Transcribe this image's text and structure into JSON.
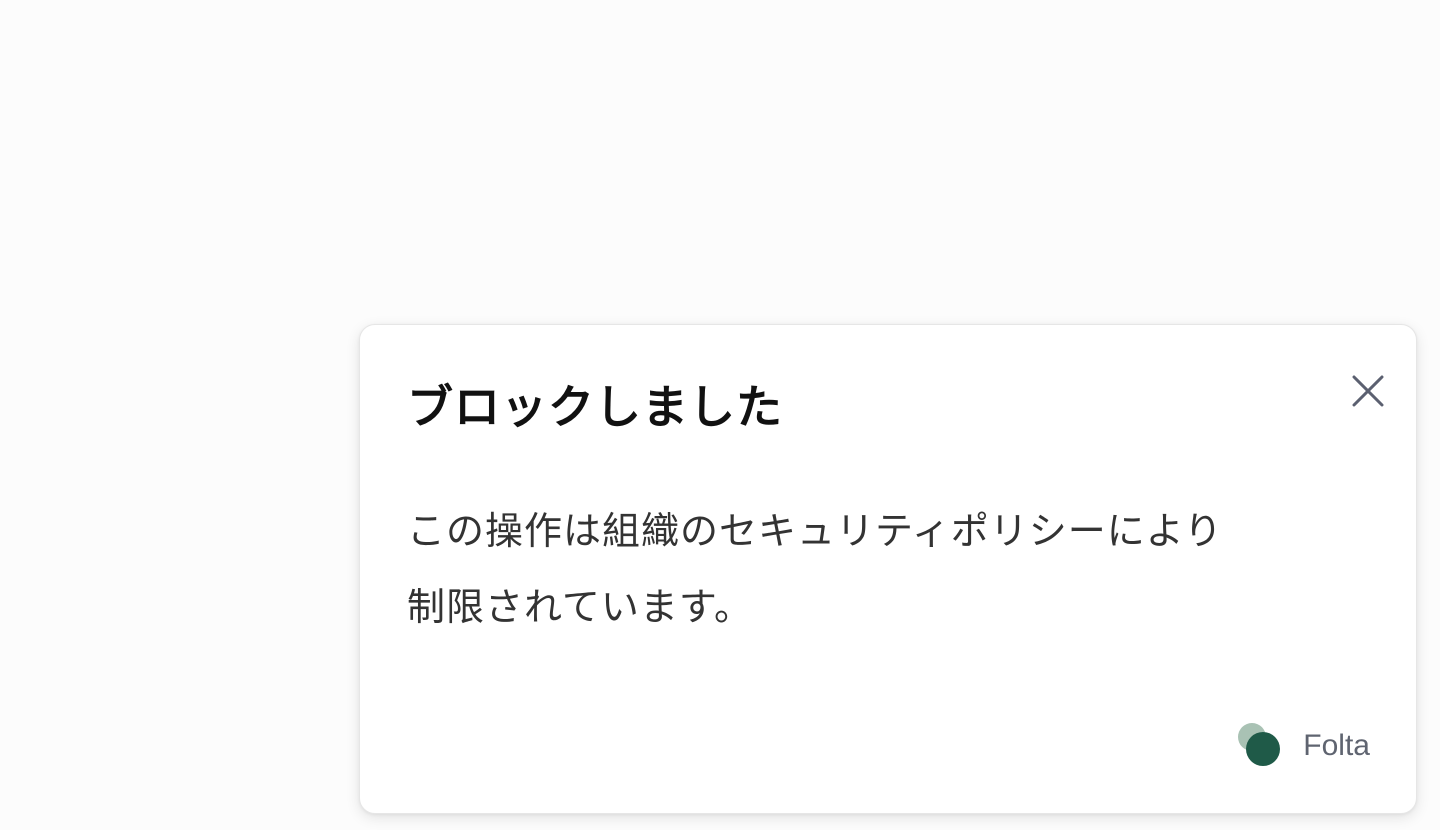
{
  "toast": {
    "title": "ブロックしました",
    "message_line1": "この操作は組織のセキュリティポリシーにより",
    "message_line2": "制限されています。",
    "close_icon": "close-icon",
    "brand": {
      "name": "Folta",
      "logo_icon": "folta-logo-icon",
      "colors": {
        "primary": "#1f5a48",
        "secondary": "#a9c2b4"
      }
    }
  }
}
